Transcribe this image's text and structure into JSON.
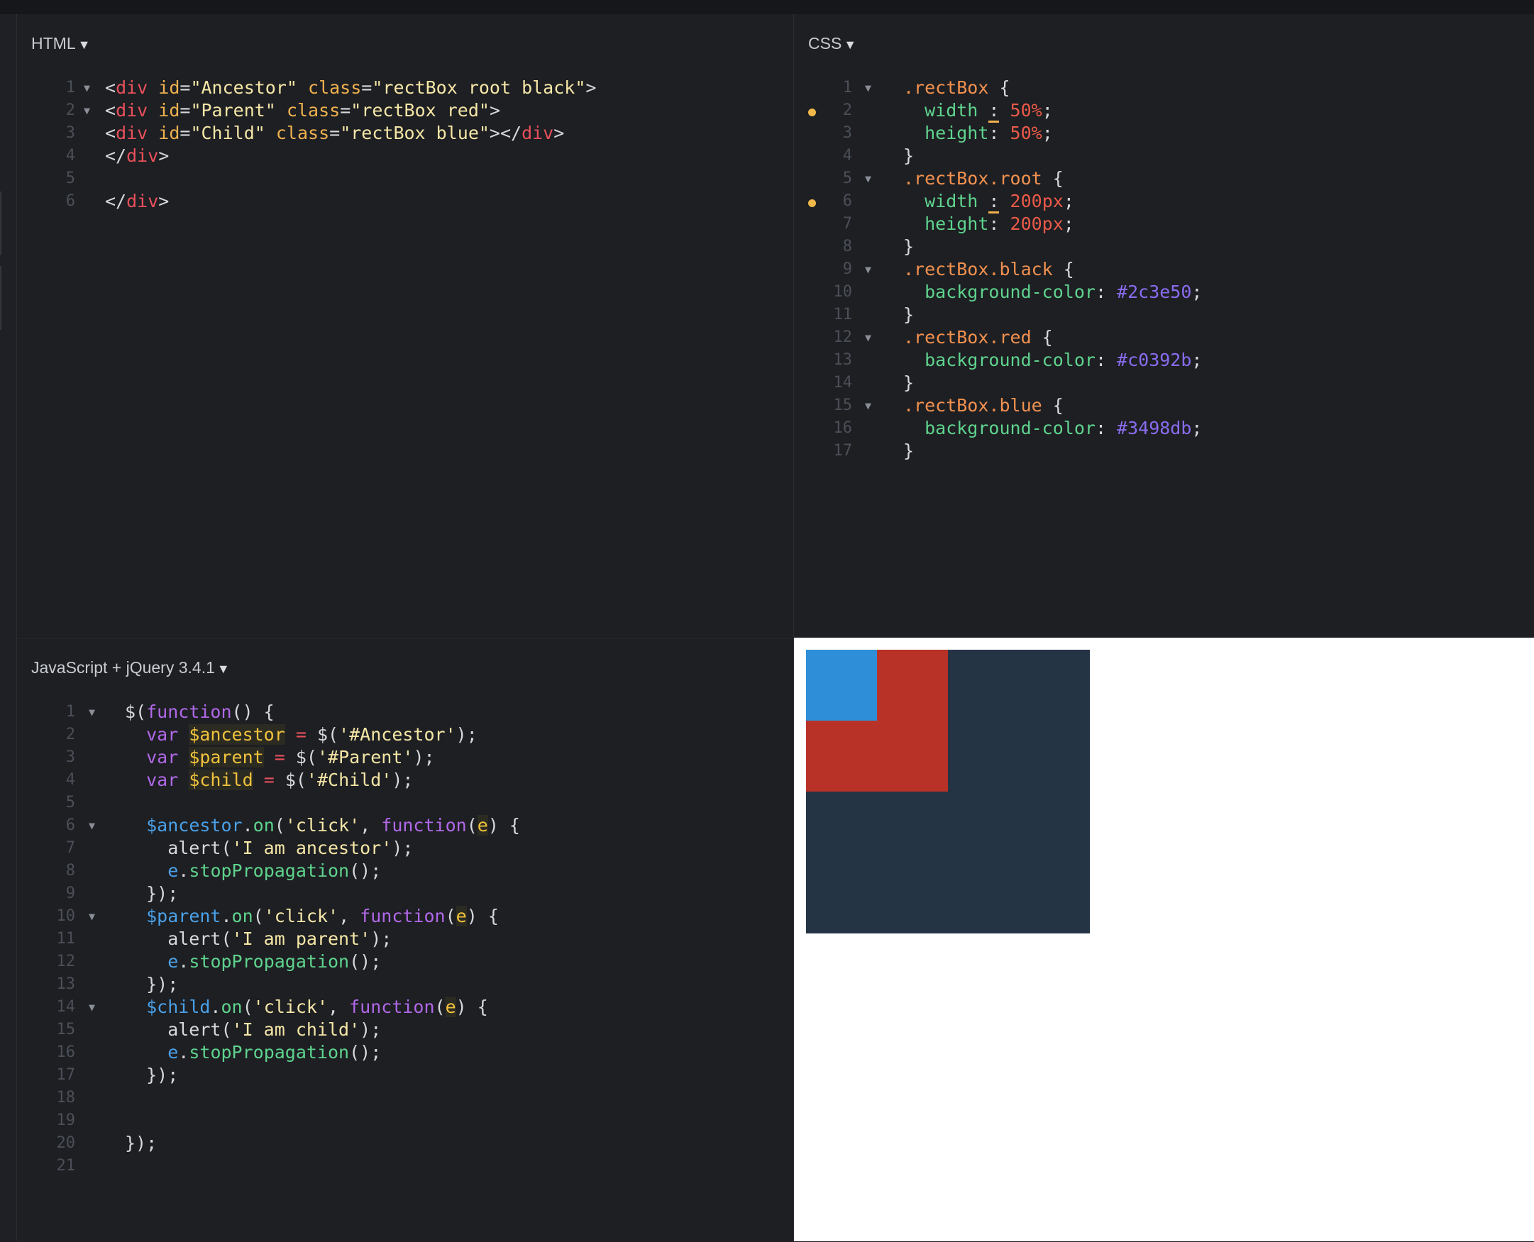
{
  "html_panel": {
    "title": "HTML",
    "caret": "▼",
    "lines": [
      {
        "n": "1",
        "fold": true,
        "tokens": [
          {
            "t": "<",
            "c": "punc"
          },
          {
            "t": "div",
            "c": "tag"
          },
          {
            "t": " ",
            "c": "punc"
          },
          {
            "t": "id",
            "c": "attr"
          },
          {
            "t": "=",
            "c": "punc"
          },
          {
            "t": "\"Ancestor\"",
            "c": "str"
          },
          {
            "t": " ",
            "c": "punc"
          },
          {
            "t": "class",
            "c": "attr"
          },
          {
            "t": "=",
            "c": "punc"
          },
          {
            "t": "\"rectBox root black\"",
            "c": "str"
          },
          {
            "t": ">",
            "c": "punc"
          }
        ]
      },
      {
        "n": "2",
        "fold": true,
        "tokens": [
          {
            "t": "<",
            "c": "punc"
          },
          {
            "t": "div",
            "c": "tag"
          },
          {
            "t": " ",
            "c": "punc"
          },
          {
            "t": "id",
            "c": "attr"
          },
          {
            "t": "=",
            "c": "punc"
          },
          {
            "t": "\"Parent\"",
            "c": "str"
          },
          {
            "t": " ",
            "c": "punc"
          },
          {
            "t": "class",
            "c": "attr"
          },
          {
            "t": "=",
            "c": "punc"
          },
          {
            "t": "\"rectBox red\"",
            "c": "str"
          },
          {
            "t": ">",
            "c": "punc"
          }
        ]
      },
      {
        "n": "3",
        "tokens": [
          {
            "t": "<",
            "c": "punc"
          },
          {
            "t": "div",
            "c": "tag"
          },
          {
            "t": " ",
            "c": "punc"
          },
          {
            "t": "id",
            "c": "attr"
          },
          {
            "t": "=",
            "c": "punc"
          },
          {
            "t": "\"Child\"",
            "c": "str"
          },
          {
            "t": " ",
            "c": "punc"
          },
          {
            "t": "class",
            "c": "attr"
          },
          {
            "t": "=",
            "c": "punc"
          },
          {
            "t": "\"rectBox blue\"",
            "c": "str"
          },
          {
            "t": "></",
            "c": "punc"
          },
          {
            "t": "div",
            "c": "tag"
          },
          {
            "t": ">",
            "c": "punc"
          }
        ]
      },
      {
        "n": "4",
        "tokens": [
          {
            "t": "</",
            "c": "punc"
          },
          {
            "t": "div",
            "c": "tag"
          },
          {
            "t": ">",
            "c": "punc"
          }
        ]
      },
      {
        "n": "5",
        "tokens": []
      },
      {
        "n": "6",
        "tokens": [
          {
            "t": "</",
            "c": "punc"
          },
          {
            "t": "div",
            "c": "tag"
          },
          {
            "t": ">",
            "c": "punc"
          }
        ]
      }
    ]
  },
  "css_panel": {
    "title": "CSS",
    "caret": "▼",
    "lines": [
      {
        "n": "1",
        "fold": true,
        "tokens": [
          {
            "t": ".rectBox",
            "c": "sel"
          },
          {
            "t": " {",
            "c": "punc"
          }
        ]
      },
      {
        "n": "2",
        "marker": true,
        "tokens": [
          {
            "t": "  width",
            "c": "prop"
          },
          {
            "t": " ",
            "c": "punc"
          },
          {
            "t": ":",
            "c": "uline"
          },
          {
            "t": " ",
            "c": "punc"
          },
          {
            "t": "50%",
            "c": "num"
          },
          {
            "t": ";",
            "c": "punc"
          }
        ]
      },
      {
        "n": "3",
        "tokens": [
          {
            "t": "  height",
            "c": "prop"
          },
          {
            "t": ": ",
            "c": "punc"
          },
          {
            "t": "50%",
            "c": "num"
          },
          {
            "t": ";",
            "c": "punc"
          }
        ]
      },
      {
        "n": "4",
        "tokens": [
          {
            "t": "}",
            "c": "punc"
          }
        ]
      },
      {
        "n": "5",
        "fold": true,
        "tokens": [
          {
            "t": ".rectBox.root",
            "c": "sel"
          },
          {
            "t": " {",
            "c": "punc"
          }
        ]
      },
      {
        "n": "6",
        "marker": true,
        "tokens": [
          {
            "t": "  width",
            "c": "prop"
          },
          {
            "t": " ",
            "c": "punc"
          },
          {
            "t": ":",
            "c": "uline"
          },
          {
            "t": " ",
            "c": "punc"
          },
          {
            "t": "200px",
            "c": "num"
          },
          {
            "t": ";",
            "c": "punc"
          }
        ]
      },
      {
        "n": "7",
        "tokens": [
          {
            "t": "  height",
            "c": "prop"
          },
          {
            "t": ": ",
            "c": "punc"
          },
          {
            "t": "200px",
            "c": "num"
          },
          {
            "t": ";",
            "c": "punc"
          }
        ]
      },
      {
        "n": "8",
        "tokens": [
          {
            "t": "}",
            "c": "punc"
          }
        ]
      },
      {
        "n": "9",
        "fold": true,
        "tokens": [
          {
            "t": ".rectBox.black",
            "c": "sel"
          },
          {
            "t": " {",
            "c": "punc"
          }
        ]
      },
      {
        "n": "10",
        "tokens": [
          {
            "t": "  background-color",
            "c": "prop"
          },
          {
            "t": ": ",
            "c": "punc"
          },
          {
            "t": "#2c3e50",
            "c": "hex"
          },
          {
            "t": ";",
            "c": "punc"
          }
        ]
      },
      {
        "n": "11",
        "tokens": [
          {
            "t": "}",
            "c": "punc"
          }
        ]
      },
      {
        "n": "12",
        "fold": true,
        "tokens": [
          {
            "t": ".rectBox.red",
            "c": "sel"
          },
          {
            "t": " {",
            "c": "punc"
          }
        ]
      },
      {
        "n": "13",
        "tokens": [
          {
            "t": "  background-color",
            "c": "prop"
          },
          {
            "t": ": ",
            "c": "punc"
          },
          {
            "t": "#c0392b",
            "c": "hex"
          },
          {
            "t": ";",
            "c": "punc"
          }
        ]
      },
      {
        "n": "14",
        "tokens": [
          {
            "t": "}",
            "c": "punc"
          }
        ]
      },
      {
        "n": "15",
        "fold": true,
        "tokens": [
          {
            "t": ".rectBox.blue",
            "c": "sel"
          },
          {
            "t": " {",
            "c": "punc"
          }
        ]
      },
      {
        "n": "16",
        "tokens": [
          {
            "t": "  background-color",
            "c": "prop"
          },
          {
            "t": ": ",
            "c": "punc"
          },
          {
            "t": "#3498db",
            "c": "hex"
          },
          {
            "t": ";",
            "c": "punc"
          }
        ]
      },
      {
        "n": "17",
        "tokens": [
          {
            "t": "}",
            "c": "punc"
          }
        ]
      }
    ]
  },
  "js_panel": {
    "title": "JavaScript + jQuery 3.4.1",
    "caret": "▼",
    "lines": [
      {
        "n": "1",
        "fold": true,
        "tokens": [
          {
            "t": "$(",
            "c": "punc"
          },
          {
            "t": "function",
            "c": "kw"
          },
          {
            "t": "() {",
            "c": "punc"
          }
        ]
      },
      {
        "n": "2",
        "tokens": [
          {
            "t": "  ",
            "c": "punc"
          },
          {
            "t": "var",
            "c": "kw"
          },
          {
            "t": " ",
            "c": "punc"
          },
          {
            "t": "$ancestor",
            "c": "var-hl"
          },
          {
            "t": " ",
            "c": "punc"
          },
          {
            "t": "=",
            "c": "op"
          },
          {
            "t": " $(",
            "c": "punc"
          },
          {
            "t": "'#Ancestor'",
            "c": "str"
          },
          {
            "t": ");",
            "c": "punc"
          }
        ]
      },
      {
        "n": "3",
        "tokens": [
          {
            "t": "  ",
            "c": "punc"
          },
          {
            "t": "var",
            "c": "kw"
          },
          {
            "t": " ",
            "c": "punc"
          },
          {
            "t": "$parent",
            "c": "var-hl"
          },
          {
            "t": " ",
            "c": "punc"
          },
          {
            "t": "=",
            "c": "op"
          },
          {
            "t": " $(",
            "c": "punc"
          },
          {
            "t": "'#Parent'",
            "c": "str"
          },
          {
            "t": ");",
            "c": "punc"
          }
        ]
      },
      {
        "n": "4",
        "tokens": [
          {
            "t": "  ",
            "c": "punc"
          },
          {
            "t": "var",
            "c": "kw"
          },
          {
            "t": " ",
            "c": "punc"
          },
          {
            "t": "$child",
            "c": "var-hl"
          },
          {
            "t": " ",
            "c": "punc"
          },
          {
            "t": "=",
            "c": "op"
          },
          {
            "t": " $(",
            "c": "punc"
          },
          {
            "t": "'#Child'",
            "c": "str"
          },
          {
            "t": ");",
            "c": "punc"
          }
        ]
      },
      {
        "n": "5",
        "tokens": []
      },
      {
        "n": "6",
        "fold": true,
        "tokens": [
          {
            "t": "  ",
            "c": "punc"
          },
          {
            "t": "$ancestor",
            "c": "obj"
          },
          {
            "t": ".",
            "c": "punc"
          },
          {
            "t": "on",
            "c": "call"
          },
          {
            "t": "(",
            "c": "punc"
          },
          {
            "t": "'click'",
            "c": "str"
          },
          {
            "t": ", ",
            "c": "punc"
          },
          {
            "t": "function",
            "c": "kw"
          },
          {
            "t": "(",
            "c": "punc"
          },
          {
            "t": "e",
            "c": "var-hl"
          },
          {
            "t": ") {",
            "c": "punc"
          }
        ]
      },
      {
        "n": "7",
        "tokens": [
          {
            "t": "    alert(",
            "c": "punc"
          },
          {
            "t": "'I am ancestor'",
            "c": "str"
          },
          {
            "t": ");",
            "c": "punc"
          }
        ]
      },
      {
        "n": "8",
        "tokens": [
          {
            "t": "    ",
            "c": "punc"
          },
          {
            "t": "e",
            "c": "obj"
          },
          {
            "t": ".",
            "c": "punc"
          },
          {
            "t": "stopPropagation",
            "c": "call"
          },
          {
            "t": "();",
            "c": "punc"
          }
        ]
      },
      {
        "n": "9",
        "tokens": [
          {
            "t": "  });",
            "c": "punc"
          }
        ]
      },
      {
        "n": "10",
        "fold": true,
        "tokens": [
          {
            "t": "  ",
            "c": "punc"
          },
          {
            "t": "$parent",
            "c": "obj"
          },
          {
            "t": ".",
            "c": "punc"
          },
          {
            "t": "on",
            "c": "call"
          },
          {
            "t": "(",
            "c": "punc"
          },
          {
            "t": "'click'",
            "c": "str"
          },
          {
            "t": ", ",
            "c": "punc"
          },
          {
            "t": "function",
            "c": "kw"
          },
          {
            "t": "(",
            "c": "punc"
          },
          {
            "t": "e",
            "c": "var-hl"
          },
          {
            "t": ") {",
            "c": "punc"
          }
        ]
      },
      {
        "n": "11",
        "tokens": [
          {
            "t": "    alert(",
            "c": "punc"
          },
          {
            "t": "'I am parent'",
            "c": "str"
          },
          {
            "t": ");",
            "c": "punc"
          }
        ]
      },
      {
        "n": "12",
        "tokens": [
          {
            "t": "    ",
            "c": "punc"
          },
          {
            "t": "e",
            "c": "obj"
          },
          {
            "t": ".",
            "c": "punc"
          },
          {
            "t": "stopPropagation",
            "c": "call"
          },
          {
            "t": "();",
            "c": "punc"
          }
        ]
      },
      {
        "n": "13",
        "tokens": [
          {
            "t": "  });",
            "c": "punc"
          }
        ]
      },
      {
        "n": "14",
        "fold": true,
        "tokens": [
          {
            "t": "  ",
            "c": "punc"
          },
          {
            "t": "$child",
            "c": "obj"
          },
          {
            "t": ".",
            "c": "punc"
          },
          {
            "t": "on",
            "c": "call"
          },
          {
            "t": "(",
            "c": "punc"
          },
          {
            "t": "'click'",
            "c": "str"
          },
          {
            "t": ", ",
            "c": "punc"
          },
          {
            "t": "function",
            "c": "kw"
          },
          {
            "t": "(",
            "c": "punc"
          },
          {
            "t": "e",
            "c": "var-hl"
          },
          {
            "t": ") {",
            "c": "punc"
          }
        ]
      },
      {
        "n": "15",
        "tokens": [
          {
            "t": "    alert(",
            "c": "punc"
          },
          {
            "t": "'I am child'",
            "c": "str"
          },
          {
            "t": ");",
            "c": "punc"
          }
        ]
      },
      {
        "n": "16",
        "tokens": [
          {
            "t": "    ",
            "c": "punc"
          },
          {
            "t": "e",
            "c": "obj"
          },
          {
            "t": ".",
            "c": "punc"
          },
          {
            "t": "stopPropagation",
            "c": "call"
          },
          {
            "t": "();",
            "c": "punc"
          }
        ]
      },
      {
        "n": "17",
        "tokens": [
          {
            "t": "  });",
            "c": "punc"
          }
        ]
      },
      {
        "n": "18",
        "tokens": []
      },
      {
        "n": "19",
        "tokens": []
      },
      {
        "n": "20",
        "tokens": [
          {
            "t": "});",
            "c": "punc"
          }
        ]
      },
      {
        "n": "21",
        "tokens": []
      }
    ]
  },
  "preview": {
    "ancestor_color": "#253445",
    "parent_color": "#b83227",
    "child_color": "#2f8ed8"
  }
}
